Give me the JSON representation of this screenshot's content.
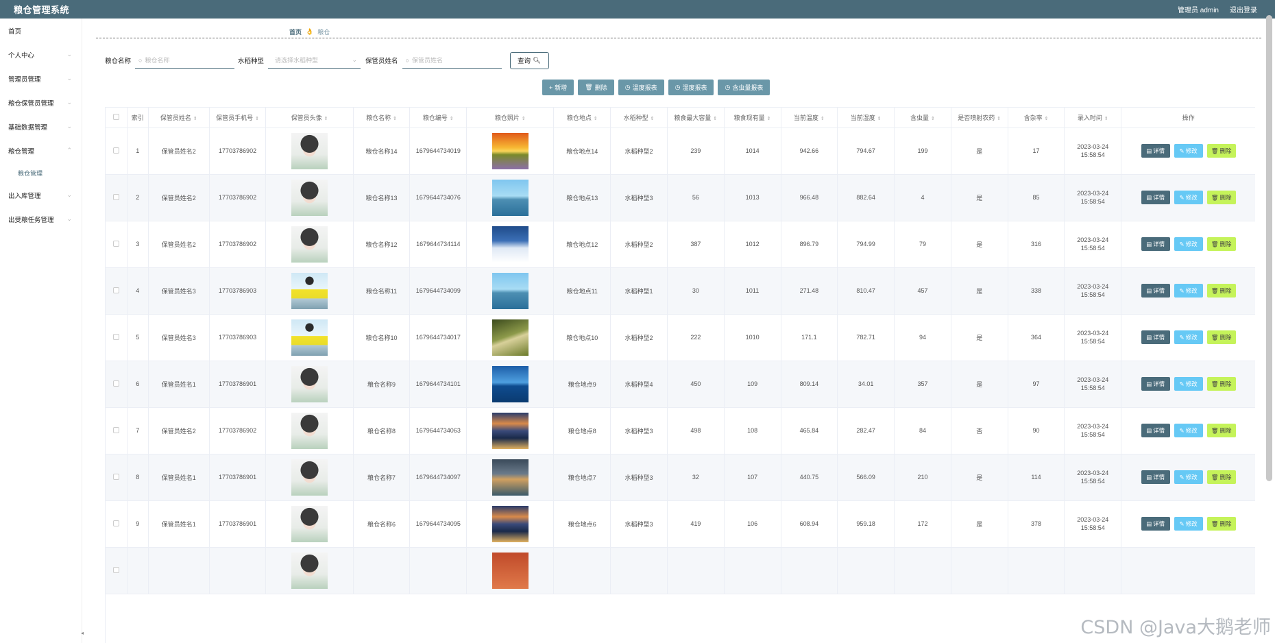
{
  "app": {
    "title": "粮仓管理系统",
    "user_label": "管理员 admin",
    "logout": "退出登录"
  },
  "sidebar": {
    "items": [
      {
        "label": "首页",
        "chevron": ""
      },
      {
        "label": "个人中心",
        "chevron": "⌄"
      },
      {
        "label": "管理员管理",
        "chevron": "⌄"
      },
      {
        "label": "粮仓保管员管理",
        "chevron": "⌄"
      },
      {
        "label": "基础数据管理",
        "chevron": "⌄"
      },
      {
        "label": "粮仓管理",
        "chevron": "⌃"
      },
      {
        "label": "出入库管理",
        "chevron": "⌄"
      },
      {
        "label": "出受粮任务管理",
        "chevron": "⌄"
      }
    ],
    "sub": {
      "label": "粮仓管理"
    },
    "foot": "◂"
  },
  "breadcrumb": {
    "home": "首页",
    "sep": "👌",
    "current": "粮仓"
  },
  "search": {
    "name_label": "粮仓名称",
    "name_placeholder": "粮仓名称",
    "type_label": "水稻种型",
    "type_placeholder": "请选择水稻种型",
    "keeper_label": "保管员姓名",
    "keeper_placeholder": "保管员姓名",
    "query": "查询"
  },
  "actions": {
    "add": "新增",
    "delete": "删除",
    "temp_report": "温度报表",
    "humid_report": "湿度报表",
    "moist_report": "含虫量报表"
  },
  "table": {
    "headers": [
      "索引",
      "保管员姓名",
      "保管员手机号",
      "保管员头像",
      "粮仓名称",
      "粮仓编号",
      "粮仓照片",
      "粮仓地点",
      "水稻种型",
      "粮食最大容量",
      "粮食现有量",
      "当前温度",
      "当前湿度",
      "含虫量",
      "是否喷射农药",
      "含杂率",
      "录入时间",
      "操作"
    ],
    "rows": [
      {
        "idx": "1",
        "keeper": "保管员姓名2",
        "phone": "17703786902",
        "name": "粮仓名称14",
        "no": "1679644734019",
        "place": "粮仓地点14",
        "type": "水稻种型2",
        "max": "239",
        "cur": "1014",
        "temp": "942.66",
        "humid": "794.67",
        "bug": "199",
        "spray": "是",
        "impurity": "17",
        "time": "2023-03-24 15:58:54"
      },
      {
        "idx": "2",
        "keeper": "保管员姓名2",
        "phone": "17703786902",
        "name": "粮仓名称13",
        "no": "1679644734076",
        "place": "粮仓地点13",
        "type": "水稻种型3",
        "max": "56",
        "cur": "1013",
        "temp": "966.48",
        "humid": "882.64",
        "bug": "4",
        "spray": "是",
        "impurity": "85",
        "time": "2023-03-24 15:58:54"
      },
      {
        "idx": "3",
        "keeper": "保管员姓名2",
        "phone": "17703786902",
        "name": "粮仓名称12",
        "no": "1679644734114",
        "place": "粮仓地点12",
        "type": "水稻种型2",
        "max": "387",
        "cur": "1012",
        "temp": "896.79",
        "humid": "794.99",
        "bug": "79",
        "spray": "是",
        "impurity": "316",
        "time": "2023-03-24 15:58:54"
      },
      {
        "idx": "4",
        "keeper": "保管员姓名3",
        "phone": "17703786903",
        "name": "粮仓名称11",
        "no": "1679644734099",
        "place": "粮仓地点11",
        "type": "水稻种型1",
        "max": "30",
        "cur": "1011",
        "temp": "271.48",
        "humid": "810.47",
        "bug": "457",
        "spray": "是",
        "impurity": "338",
        "time": "2023-03-24 15:58:54"
      },
      {
        "idx": "5",
        "keeper": "保管员姓名3",
        "phone": "17703786903",
        "name": "粮仓名称10",
        "no": "1679644734017",
        "place": "粮仓地点10",
        "type": "水稻种型2",
        "max": "222",
        "cur": "1010",
        "temp": "171.1",
        "humid": "782.71",
        "bug": "94",
        "spray": "是",
        "impurity": "364",
        "time": "2023-03-24 15:58:54"
      },
      {
        "idx": "6",
        "keeper": "保管员姓名1",
        "phone": "17703786901",
        "name": "粮仓名称9",
        "no": "1679644734101",
        "place": "粮仓地点9",
        "type": "水稻种型4",
        "max": "450",
        "cur": "109",
        "temp": "809.14",
        "humid": "34.01",
        "bug": "357",
        "spray": "是",
        "impurity": "97",
        "time": "2023-03-24 15:58:54"
      },
      {
        "idx": "7",
        "keeper": "保管员姓名2",
        "phone": "17703786902",
        "name": "粮仓名称8",
        "no": "1679644734063",
        "place": "粮仓地点8",
        "type": "水稻种型3",
        "max": "498",
        "cur": "108",
        "temp": "465.84",
        "humid": "282.47",
        "bug": "84",
        "spray": "否",
        "impurity": "90",
        "time": "2023-03-24 15:58:54"
      },
      {
        "idx": "8",
        "keeper": "保管员姓名1",
        "phone": "17703786901",
        "name": "粮仓名称7",
        "no": "1679644734097",
        "place": "粮仓地点7",
        "type": "水稻种型3",
        "max": "32",
        "cur": "107",
        "temp": "440.75",
        "humid": "566.09",
        "bug": "210",
        "spray": "是",
        "impurity": "114",
        "time": "2023-03-24 15:58:54"
      },
      {
        "idx": "9",
        "keeper": "保管员姓名1",
        "phone": "17703786901",
        "name": "粮仓名称6",
        "no": "1679644734095",
        "place": "粮仓地点6",
        "type": "水稻种型3",
        "max": "419",
        "cur": "106",
        "temp": "608.94",
        "humid": "959.18",
        "bug": "172",
        "spray": "是",
        "impurity": "378",
        "time": "2023-03-24 15:58:54"
      },
      {
        "idx": "",
        "keeper": "",
        "phone": "",
        "name": "",
        "no": "",
        "place": "",
        "type": "",
        "max": "",
        "cur": "",
        "temp": "",
        "humid": "",
        "bug": "",
        "spray": "",
        "impurity": "",
        "time": ""
      }
    ],
    "op": {
      "detail": "详情",
      "edit": "修改",
      "del": "删除"
    }
  },
  "watermark": "CSDN @Java大鹅老师"
}
